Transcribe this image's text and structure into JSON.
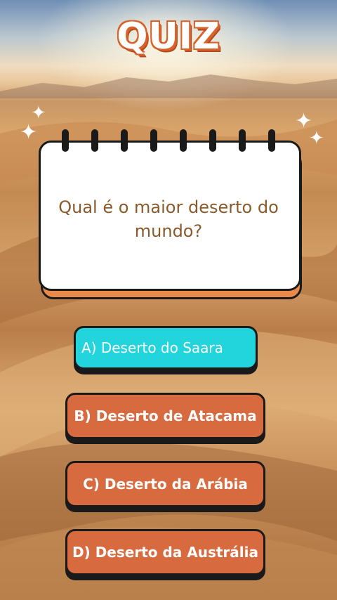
{
  "title": "QUIZ",
  "question": "Qual é o maior deserto do mundo?",
  "options": [
    {
      "label": "A) Deserto do Saara",
      "selected": true,
      "color": "#22d4dc"
    },
    {
      "label": "B) Deserto de Atacama",
      "selected": false,
      "color": "#d86a3f"
    },
    {
      "label": "C) Deserto da Arábia",
      "selected": false,
      "color": "#d86a3f"
    },
    {
      "label": "D) Deserto da Austrália",
      "selected": false,
      "color": "#d86a3f"
    }
  ],
  "colors": {
    "accent_orange": "#d86a3f",
    "highlight_cyan": "#22d4dc",
    "question_text": "#8a5a2b"
  }
}
